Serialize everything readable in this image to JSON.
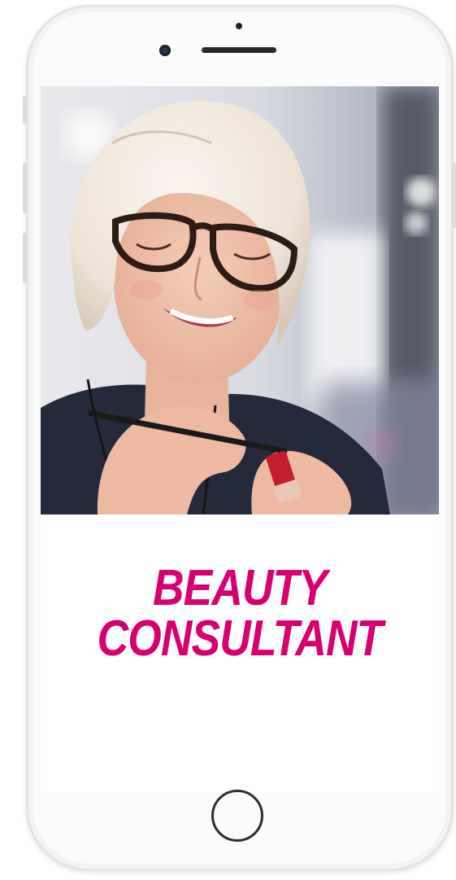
{
  "device": {
    "type": "smartphone",
    "color": "white"
  },
  "screen": {
    "photo": {
      "description_icon": "woman-applying-lipstick-photo"
    },
    "title": {
      "line1": "BEAUTY",
      "line2": "CONSULTANT",
      "color": "#d6006e"
    }
  }
}
